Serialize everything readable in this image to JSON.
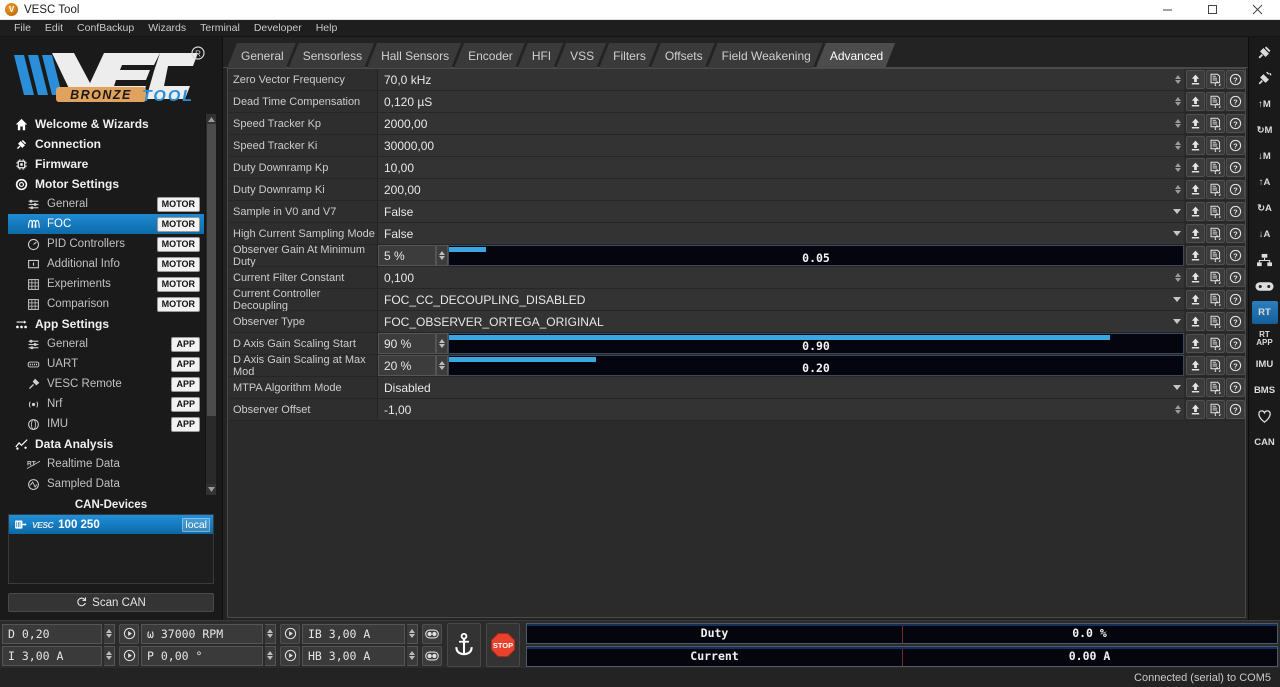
{
  "window": {
    "title": "VESC Tool",
    "icon": "vesc-logo-icon",
    "minimize": "minimize-icon",
    "maximize": "maximize-icon",
    "close": "close-icon"
  },
  "menubar": {
    "items": [
      "File",
      "Edit",
      "ConfBackup",
      "Wizards",
      "Terminal",
      "Developer",
      "Help"
    ]
  },
  "logo": {
    "brand": "VESC",
    "edition": "BRONZE",
    "product": "TOOL",
    "trademark": "®"
  },
  "sidebar": {
    "items": [
      {
        "label": "Welcome & Wizards",
        "icon": "home-icon",
        "type": "group",
        "badge": ""
      },
      {
        "label": "Connection",
        "icon": "plug-icon",
        "type": "group",
        "badge": ""
      },
      {
        "label": "Firmware",
        "icon": "chip-icon",
        "type": "group",
        "badge": ""
      },
      {
        "label": "Motor Settings",
        "icon": "gear-icon",
        "type": "group",
        "badge": ""
      },
      {
        "label": "General",
        "icon": "sliders-icon",
        "type": "child",
        "badge": "MOTOR"
      },
      {
        "label": "FOC",
        "icon": "coil-icon",
        "type": "child",
        "badge": "MOTOR",
        "selected": true
      },
      {
        "label": "PID Controllers",
        "icon": "gauge-icon",
        "type": "child",
        "badge": "MOTOR"
      },
      {
        "label": "Additional Info",
        "icon": "info-icon",
        "type": "child",
        "badge": "MOTOR"
      },
      {
        "label": "Experiments",
        "icon": "grid-icon",
        "type": "child",
        "badge": "MOTOR"
      },
      {
        "label": "Comparison",
        "icon": "grid-icon",
        "type": "child",
        "badge": "MOTOR"
      },
      {
        "label": "App Settings",
        "icon": "apps-icon",
        "type": "group",
        "badge": ""
      },
      {
        "label": "General",
        "icon": "sliders-icon",
        "type": "child",
        "badge": "APP"
      },
      {
        "label": "UART",
        "icon": "uart-icon",
        "type": "child",
        "badge": "APP"
      },
      {
        "label": "VESC Remote",
        "icon": "remote-icon",
        "type": "child",
        "badge": "APP"
      },
      {
        "label": "Nrf",
        "icon": "wireless-icon",
        "type": "child",
        "badge": "APP"
      },
      {
        "label": "IMU",
        "icon": "imu-icon",
        "type": "child",
        "badge": "APP"
      },
      {
        "label": "Data Analysis",
        "icon": "analysis-icon",
        "type": "group",
        "badge": ""
      },
      {
        "label": "Realtime Data",
        "icon": "rt-icon",
        "type": "child",
        "badge": ""
      },
      {
        "label": "Sampled Data",
        "icon": "sampled-icon",
        "type": "child",
        "badge": ""
      }
    ],
    "can_devices": {
      "title": "CAN-Devices",
      "rows": [
        {
          "brand": "VESC",
          "name": "100 250",
          "tag": "local",
          "icon": "device-icon"
        }
      ],
      "scan_button": "Scan CAN",
      "scan_icon": "refresh-icon"
    }
  },
  "tabs": [
    {
      "label": "General",
      "active": false
    },
    {
      "label": "Sensorless",
      "active": false
    },
    {
      "label": "Hall Sensors",
      "active": false
    },
    {
      "label": "Encoder",
      "active": false
    },
    {
      "label": "HFI",
      "active": false
    },
    {
      "label": "VSS",
      "active": false
    },
    {
      "label": "Filters",
      "active": false
    },
    {
      "label": "Offsets",
      "active": false
    },
    {
      "label": "Field Weakening",
      "active": false
    },
    {
      "label": "Advanced",
      "active": true
    }
  ],
  "row_actions": {
    "upload_icon": "upload-icon",
    "read_icon": "read-default-icon",
    "help_icon": "help-icon"
  },
  "parameters": [
    {
      "name": "Zero Vector Frequency",
      "value": "70,0 kHz",
      "control": "spin"
    },
    {
      "name": "Dead Time Compensation",
      "value": "0,120 µS",
      "control": "spin"
    },
    {
      "name": "Speed Tracker Kp",
      "value": "2000,00",
      "control": "spin"
    },
    {
      "name": "Speed Tracker Ki",
      "value": "30000,00",
      "control": "spin"
    },
    {
      "name": "Duty Downramp Kp",
      "value": "10,00",
      "control": "spin"
    },
    {
      "name": "Duty Downramp Ki",
      "value": "200,00",
      "control": "spin"
    },
    {
      "name": "Sample in V0 and V7",
      "value": "False",
      "control": "dropdown"
    },
    {
      "name": "High Current Sampling Mode",
      "value": "False",
      "control": "dropdown"
    },
    {
      "name": "Observer Gain At Minimum Duty",
      "value": "5 %",
      "control": "slider",
      "slider_value": "0.05",
      "fill_percent": 5
    },
    {
      "name": "Current Filter Constant",
      "value": "0,100",
      "control": "spin"
    },
    {
      "name": "Current Controller Decoupling",
      "value": "FOC_CC_DECOUPLING_DISABLED",
      "control": "dropdown"
    },
    {
      "name": "Observer Type",
      "value": "FOC_OBSERVER_ORTEGA_ORIGINAL",
      "control": "dropdown"
    },
    {
      "name": "D Axis Gain Scaling Start",
      "value": "90 %",
      "control": "slider",
      "slider_value": "0.90",
      "fill_percent": 90
    },
    {
      "name": "D Axis Gain Scaling at Max Mod",
      "value": "20 %",
      "control": "slider",
      "slider_value": "0.20",
      "fill_percent": 20
    },
    {
      "name": "MTPA Algorithm Mode",
      "value": "Disabled",
      "control": "dropdown"
    },
    {
      "name": "Observer Offset",
      "value": "-1,00",
      "control": "spin"
    }
  ],
  "right_toolbar": [
    {
      "label": "",
      "icon": "connect-icon",
      "selected": false
    },
    {
      "label": "",
      "icon": "disconnect-icon",
      "selected": false
    },
    {
      "label": "↑M",
      "icon": "write-motor-icon",
      "selected": false
    },
    {
      "label": "↻M",
      "icon": "reboot-motor-icon",
      "selected": false
    },
    {
      "label": "↓M",
      "icon": "read-motor-icon",
      "selected": false
    },
    {
      "label": "↑A",
      "icon": "write-app-icon",
      "selected": false
    },
    {
      "label": "↻A",
      "icon": "reboot-app-icon",
      "selected": false
    },
    {
      "label": "↓A",
      "icon": "read-app-icon",
      "selected": false
    },
    {
      "label": "",
      "icon": "can-network-icon",
      "selected": false
    },
    {
      "label": "",
      "icon": "gamepad-icon",
      "selected": false
    },
    {
      "label": "RT",
      "icon": "realtime-icon",
      "selected": true
    },
    {
      "label": "RT\nAPP",
      "icon": "realtime-app-icon",
      "selected": false
    },
    {
      "label": "IMU",
      "icon": "imu-icon",
      "selected": false
    },
    {
      "label": "BMS",
      "icon": "bms-icon",
      "selected": false
    },
    {
      "label": "",
      "icon": "heart-icon",
      "selected": false
    },
    {
      "label": "CAN",
      "icon": "can-icon",
      "selected": false
    }
  ],
  "bottom_bar": {
    "controls": [
      {
        "field": "D 0,20",
        "icon": "play-icon"
      },
      {
        "field": "ω 37000 RPM",
        "icon": "play-icon"
      },
      {
        "field": "IB 3,00 A",
        "icon": "toggle-icon"
      },
      {
        "field": "I 3,00 A",
        "icon": "play-icon"
      },
      {
        "field": "P 0,00 °",
        "icon": "play-icon"
      },
      {
        "field": "HB 3,00 A",
        "icon": "toggle-icon"
      }
    ],
    "anchor_button": "anchor-icon",
    "stop_button": "stop-icon",
    "stop_label": "STOP",
    "gauges": [
      {
        "label": "Duty",
        "value": "0.0 %"
      },
      {
        "label": "Current",
        "value": "0.00 A"
      }
    ]
  },
  "statusbar": {
    "text": "Connected (serial) to COM5"
  }
}
